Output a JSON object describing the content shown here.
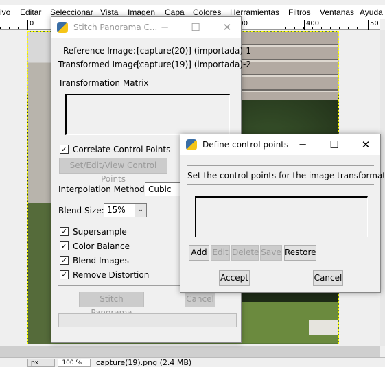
{
  "menubar": {
    "items": [
      "ivo",
      "Editar",
      "Seleccionar",
      "Vista",
      "Imagen",
      "Capa",
      "Colores",
      "Herramientas",
      "Filtros",
      "Ventanas",
      "Ayuda"
    ]
  },
  "ruler": {
    "ticks": [
      "0",
      "300",
      "400",
      "50"
    ]
  },
  "status": {
    "unit": "px",
    "zoom": "100 %",
    "filename": "capture(19).png (2.4 MB)"
  },
  "stitch_dialog": {
    "title": "Stitch Panorama C...",
    "reference_label": "Reference Image:",
    "reference_value": "[capture(20)] (importada)-1",
    "transformed_label": "Transformed Image:",
    "transformed_value": "[capture(19)] (importada)-2",
    "matrix_label": "Transformation Matrix",
    "correlate": {
      "label": "Correlate Control Points",
      "checked": true
    },
    "set_edit_button": "Set/Edit/View Control Points",
    "interp_label": "Interpolation Method:",
    "interp_value": "Cubic",
    "blend_label": "Blend Size:",
    "blend_value": "15%",
    "checks": [
      {
        "label": "Supersample",
        "checked": true
      },
      {
        "label": "Color Balance",
        "checked": true
      },
      {
        "label": "Blend Images",
        "checked": true
      },
      {
        "label": "Remove Distortion",
        "checked": true
      }
    ],
    "stitch_button": "Stitch Panorama",
    "cancel_button": "Cancel",
    "progress": 0
  },
  "control_dialog": {
    "title": "Define control points",
    "instruction": "Set the control points for the image transformation.",
    "buttons": {
      "add": "Add",
      "edit": "Edit",
      "delete": "Delete",
      "save": "Save",
      "restore": "Restore"
    },
    "accept": "Accept",
    "cancel": "Cancel"
  },
  "icons": {
    "minimize": "─",
    "maximize": "☐",
    "close": "✕",
    "check": "✓",
    "chevron": "⌄"
  }
}
